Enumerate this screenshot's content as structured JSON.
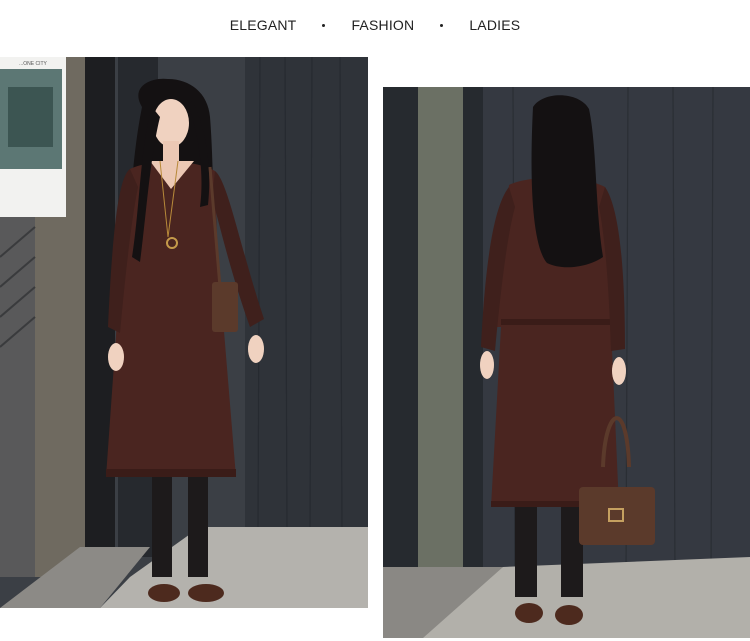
{
  "header": {
    "words": [
      "ELEGANT",
      "FASHION",
      "LADIES"
    ]
  },
  "poster": {
    "lines": [
      "...ONE CITY"
    ]
  },
  "colors": {
    "dress": "#4a2520",
    "dress_shadow": "#3a1c18",
    "wall": "#3b3f45",
    "ground": "#b8b6b0",
    "hair": "#141112",
    "skin": "#f0d2c0",
    "tights": "#1d1a1b",
    "shoes": "#4d2a1e",
    "bag": "#5b3a2b"
  },
  "photos": [
    {
      "id": "left",
      "subject": "front-view"
    },
    {
      "id": "right",
      "subject": "back-view"
    }
  ]
}
